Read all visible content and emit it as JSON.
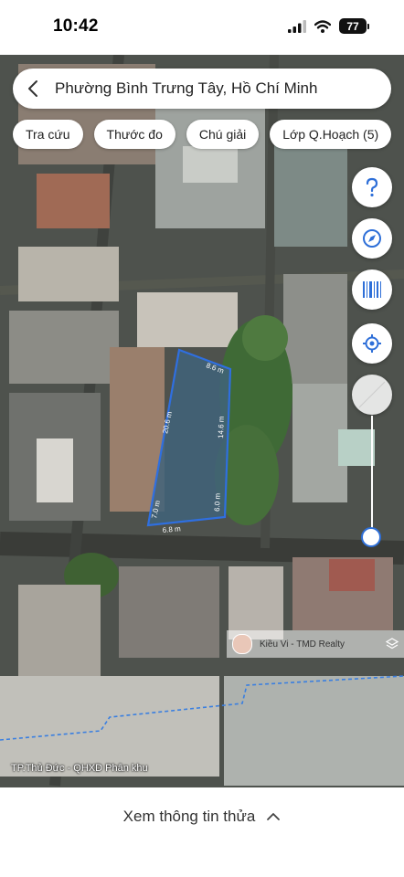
{
  "status_bar": {
    "time": "10:42",
    "battery": "77"
  },
  "search": {
    "location": "Phường Bình Trưng Tây, Hồ Chí Minh"
  },
  "chips": [
    "Tra cứu",
    "Thước đo",
    "Chú giải",
    "Lớp Q.Hoạch (5)"
  ],
  "map": {
    "plot_dimensions": {
      "top": "8.6 m",
      "left": "20.6 m",
      "right": "14.6 m",
      "right_lower": "6.0 m",
      "left_lower": "7.0 m",
      "bottom": "6.8 m"
    },
    "agent_label": "Kiều Vi - TMD Realty",
    "source_label": "TP.Thủ Đức - QHXD Phân khu",
    "plot_outline_color": "#2f6fe0"
  },
  "controls": {
    "help_icon": "question-icon",
    "compass_icon": "compass-icon",
    "barcode_icon": "barcode-icon",
    "locate_icon": "locate-icon"
  },
  "bottom_sheet": {
    "title": "Xem thông tin thửa"
  }
}
